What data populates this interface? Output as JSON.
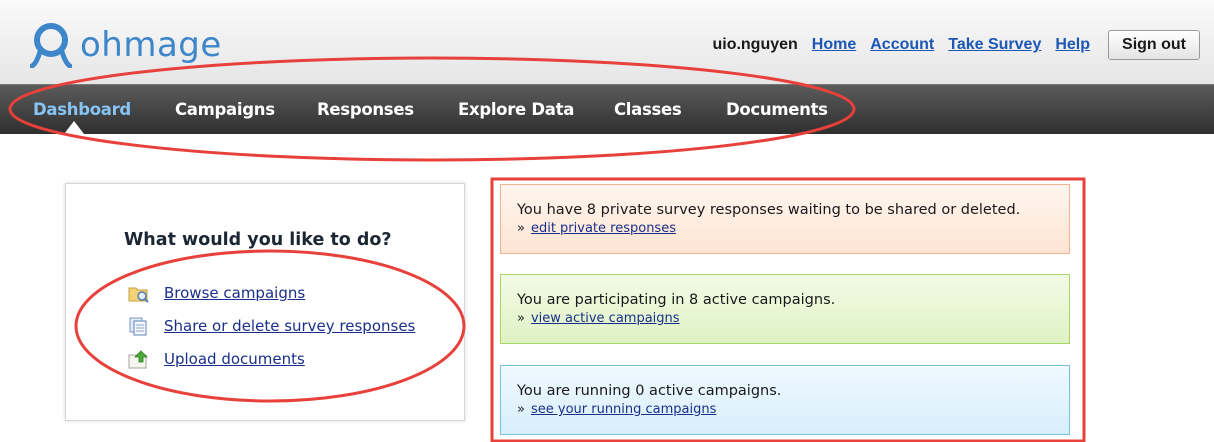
{
  "app": {
    "logo_text": "ohmage",
    "brand_color": "#3c86c9"
  },
  "top_nav": {
    "username": "uio.nguyen",
    "links": [
      "Home",
      "Account",
      "Take Survey",
      "Help"
    ],
    "signout_label": "Sign out"
  },
  "main_nav": {
    "items": [
      "Dashboard",
      "Campaigns",
      "Responses",
      "Explore Data",
      "Classes",
      "Documents"
    ],
    "active": "Dashboard"
  },
  "todo": {
    "title": "What would you like to do?",
    "links": [
      {
        "label": "Browse campaigns",
        "icon": "folder-search-icon"
      },
      {
        "label": "Share or delete survey responses",
        "icon": "documents-icon"
      },
      {
        "label": "Upload documents",
        "icon": "upload-icon"
      }
    ]
  },
  "notices": [
    {
      "text": "You have 8 private survey responses waiting to be shared or deleted.",
      "bullet": "»",
      "link": "edit private responses",
      "color": "#f0b58f"
    },
    {
      "text": "You are participating in 8 active campaigns.",
      "bullet": "»",
      "link": "view active campaigns",
      "color": "#a8d46a"
    },
    {
      "text": "You are running 0 active campaigns.",
      "bullet": "»",
      "link": "see your running campaigns",
      "color": "#7cc1e6"
    }
  ],
  "annotation_color": "#e8403a"
}
